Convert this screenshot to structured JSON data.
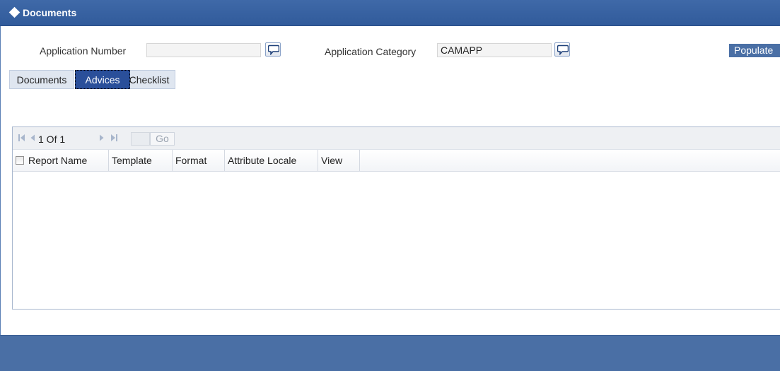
{
  "window": {
    "title": "Documents"
  },
  "form": {
    "application_number_label": "Application Number",
    "application_number_value": "",
    "application_category_label": "Application Category",
    "application_category_value": "CAMAPP",
    "populate_label": "Populate"
  },
  "tabs": [
    {
      "label": "Documents",
      "selected": false
    },
    {
      "label": "Advices",
      "selected": true
    },
    {
      "label": "Checklist",
      "selected": false
    }
  ],
  "pager": {
    "page_info": "1 Of 1",
    "page_input": "",
    "go_label": "Go"
  },
  "table": {
    "columns": [
      "Report Name",
      "Template",
      "Format",
      "Attribute Locale",
      "View"
    ],
    "rows": []
  },
  "icons": {
    "title": "diamond-icon",
    "lov": "speech-bubble-icon",
    "first": "first-page-icon",
    "prev": "prev-page-icon",
    "next": "next-page-icon",
    "last": "last-page-icon"
  },
  "colors": {
    "title_bar": "#3a64a3",
    "selected_tab": "#2a4f9a",
    "footer": "#4a6fa5",
    "populate_button": "#4a6fa5"
  }
}
